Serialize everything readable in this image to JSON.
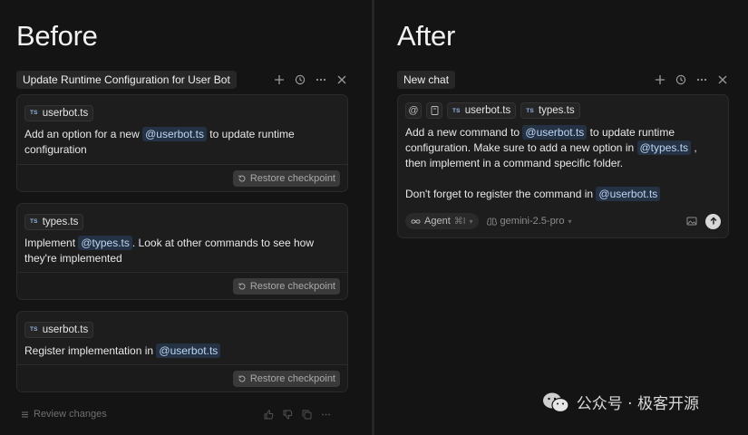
{
  "before": {
    "heading": "Before",
    "chat_title": "Update Runtime Configuration for User Bot",
    "cards": [
      {
        "file": "userbot.ts",
        "text_pre": "Add an option for a new ",
        "mention": "@userbot.ts",
        "text_post": " to update runtime configuration",
        "restore_label": "Restore checkpoint"
      },
      {
        "file": "types.ts",
        "text_pre": "Implement ",
        "mention": "@types.ts",
        "text_post": ". Look at other commands to see how they're implemented",
        "restore_label": "Restore checkpoint"
      },
      {
        "file": "userbot.ts",
        "text_pre": "Register implementation in ",
        "mention": "@userbot.ts",
        "text_post": "",
        "restore_label": "Restore checkpoint"
      }
    ],
    "review_label": "Review changes"
  },
  "after": {
    "heading": "After",
    "chat_title": "New chat",
    "chips": [
      "userbot.ts",
      "types.ts"
    ],
    "at_symbol": "@",
    "msg1_a": "Add a new command to ",
    "msg1_mention1": "@userbot.ts",
    "msg1_b": " to update runtime configuration.  Make sure to add a new option in ",
    "msg1_mention2": "@types.ts",
    "msg1_c": " , then implement in a command specific folder.",
    "msg2_a": "Don't forget to register the command in ",
    "msg2_mention": "@userbot.ts",
    "mode_label": "Agent",
    "mode_shortcut": "⌘I",
    "model_label": "gemini-2.5-pro"
  },
  "watermark": {
    "text": "公众号 · 极客开源"
  },
  "icons": {
    "ts_badge": "TS"
  },
  "colors": {
    "background": "#141414",
    "card": "#1d1d1d",
    "mention_bg": "#253244",
    "mention_fg": "#bcd6f5"
  }
}
